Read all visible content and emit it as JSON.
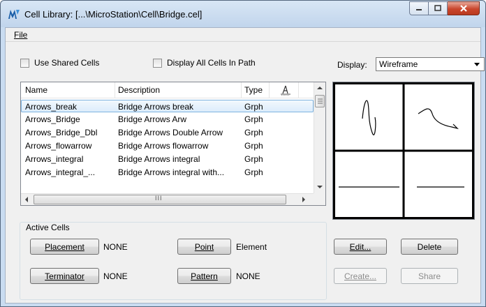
{
  "window": {
    "title": "Cell Library: [...\\MicroStation\\Cell\\Bridge.cel]",
    "accent": "#c9dcf1"
  },
  "menu": {
    "file_label": "File"
  },
  "options": {
    "use_shared_cells": {
      "label": "Use Shared Cells",
      "checked": false
    },
    "display_all_cells": {
      "label": "Display All Cells In Path",
      "checked": false
    },
    "display_label": "Display:",
    "display_value": "Wireframe"
  },
  "list": {
    "columns": {
      "name": "Name",
      "description": "Description",
      "type": "Type"
    },
    "rows": [
      {
        "name": "Arrows_break",
        "description": "Bridge Arrows break",
        "type": "Grph",
        "selected": true
      },
      {
        "name": "Arrows_Bridge",
        "description": "Bridge Arrows Arw",
        "type": "Grph",
        "selected": false
      },
      {
        "name": "Arrows_Bridge_Dbl",
        "description": "Bridge Arrows Double Arrow",
        "type": "Grph",
        "selected": false
      },
      {
        "name": "Arrows_flowarrow",
        "description": "Bridge Arrows flowarrow",
        "type": "Grph",
        "selected": false
      },
      {
        "name": "Arrows_integral",
        "description": "Bridge Arrows integral",
        "type": "Grph",
        "selected": false
      },
      {
        "name": "Arrows_integral_...",
        "description": "Bridge Arrows integral with...",
        "type": "Grph",
        "selected": false
      }
    ],
    "hscroll_grip": "III"
  },
  "active_cells": {
    "group_label": "Active Cells",
    "placement_label": "Placement",
    "placement_value": "NONE",
    "point_label": "Point",
    "point_value": "Element",
    "terminator_label": "Terminator",
    "terminator_value": "NONE",
    "pattern_label": "Pattern",
    "pattern_value": "NONE"
  },
  "actions": {
    "edit_label": "Edit...",
    "delete_label": "Delete",
    "create_label": "Create...",
    "share_label": "Share"
  }
}
